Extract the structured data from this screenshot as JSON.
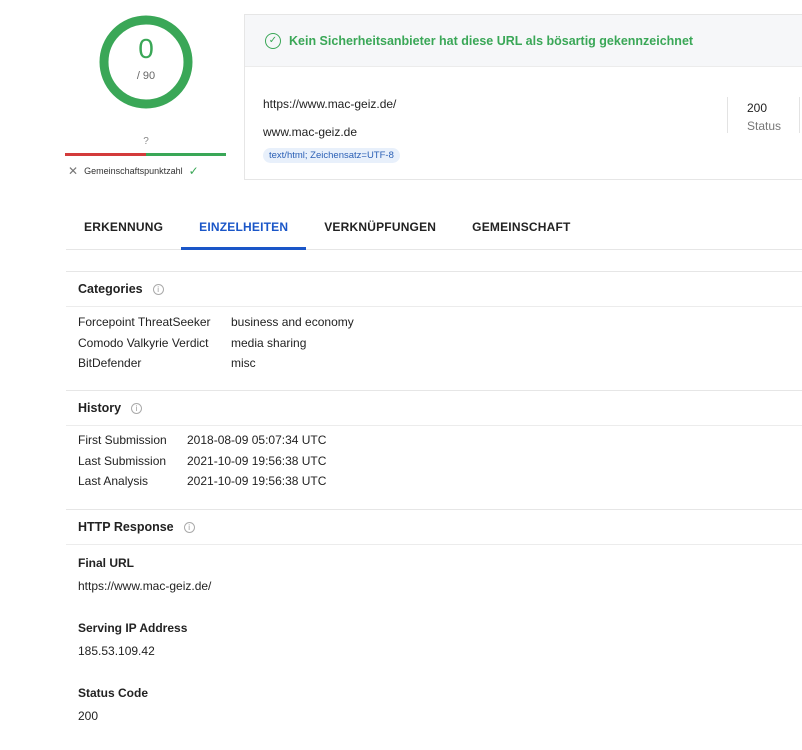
{
  "score": {
    "value": "0",
    "total": "/ 90",
    "unknown": "?",
    "community_label": "Gemeinschaftspunktzahl",
    "colors": {
      "ring": "#3aa757",
      "bad": "#d33b3b",
      "good": "#3aa757"
    }
  },
  "banner": {
    "text": "Kein Sicherheitsanbieter hat diese URL als bösartig gekennzeichnet"
  },
  "summary": {
    "url": "https://www.mac-geiz.de/",
    "host": "www.mac-geiz.de",
    "content_type": "text/html; Zeichensatz=UTF-8",
    "status_value": "200",
    "status_label": "Status"
  },
  "tabs": [
    {
      "label": "ERKENNUNG",
      "active": false
    },
    {
      "label": "EINZELHEITEN",
      "active": true
    },
    {
      "label": "VERKNÜPFUNGEN",
      "active": false
    },
    {
      "label": "GEMEINSCHAFT",
      "active": false
    }
  ],
  "categories": {
    "title": "Categories",
    "rows": [
      {
        "key": "Forcepoint ThreatSeeker",
        "value": "business and economy"
      },
      {
        "key": "Comodo Valkyrie Verdict",
        "value": "media sharing"
      },
      {
        "key": "BitDefender",
        "value": "misc"
      }
    ]
  },
  "history": {
    "title": "History",
    "rows": [
      {
        "key": "First Submission",
        "value": "2018-08-09 05:07:34 UTC"
      },
      {
        "key": "Last Submission",
        "value": "2021-10-09 19:56:38 UTC"
      },
      {
        "key": "Last Analysis",
        "value": "2021-10-09 19:56:38 UTC"
      }
    ]
  },
  "http_response": {
    "title": "HTTP Response",
    "final_url_label": "Final URL",
    "final_url": "https://www.mac-geiz.de/",
    "ip_label": "Serving IP Address",
    "ip": "185.53.109.42",
    "status_label": "Status Code",
    "status": "200"
  }
}
